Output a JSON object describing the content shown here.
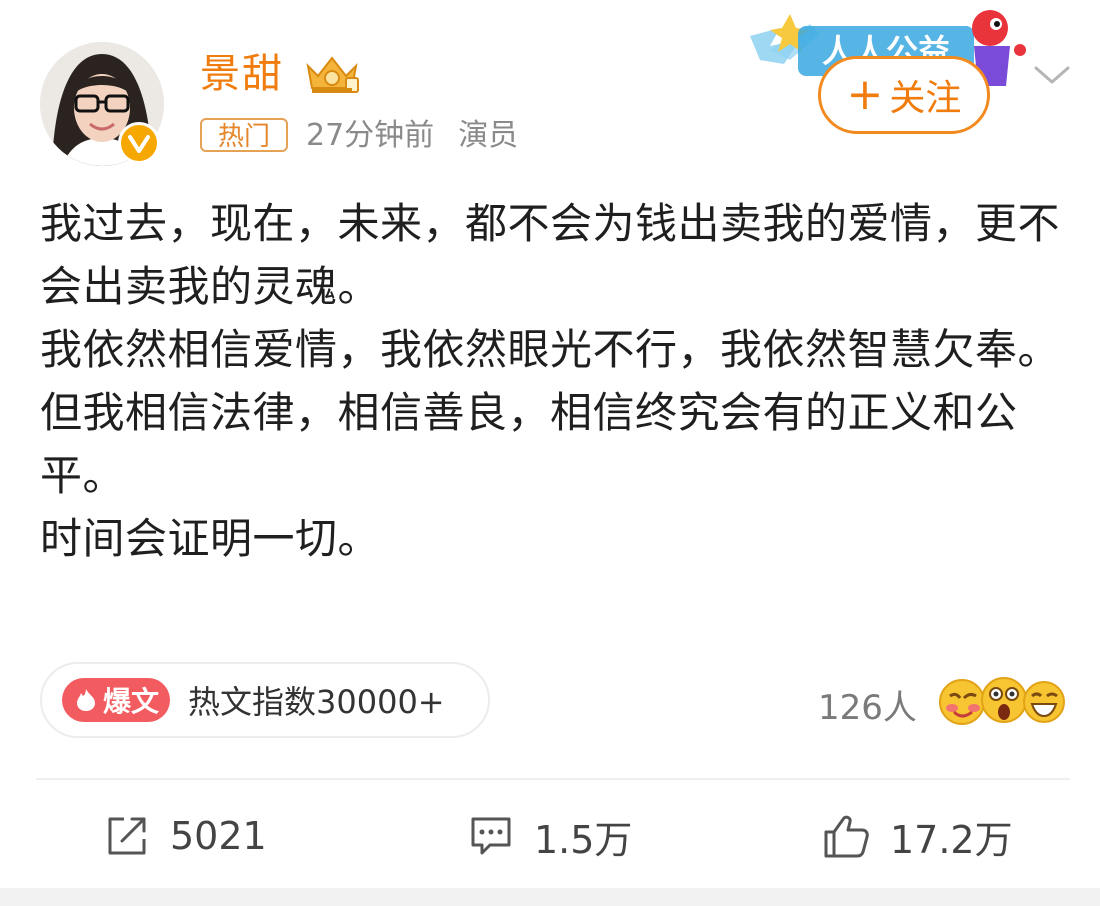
{
  "user": {
    "name": "景甜",
    "tag": "热门",
    "time": "27分钟前",
    "role": "演员"
  },
  "follow_button": {
    "plus": "+",
    "label": "关注"
  },
  "promo_banner": {
    "text": "人人公益"
  },
  "post": {
    "lines": [
      "我过去，现在，未来，都不会为钱出卖我的爱情，更不会出卖我的灵魂。",
      "我依然相信爱情，我依然眼光不行，我依然智慧欠奉。",
      "但我相信法律，相信善良，相信终究会有的正义和公平。",
      "时间会证明一切。"
    ]
  },
  "hot_article": {
    "badge": "爆文",
    "index_text": "热文指数30000+"
  },
  "reactions": {
    "count_text": "126人"
  },
  "actions": {
    "repost": "5021",
    "comment": "1.5万",
    "like": "17.2万"
  },
  "colors": {
    "accent": "#f07c0e",
    "verified": "#f6a800",
    "baowen": "#f25b60"
  }
}
